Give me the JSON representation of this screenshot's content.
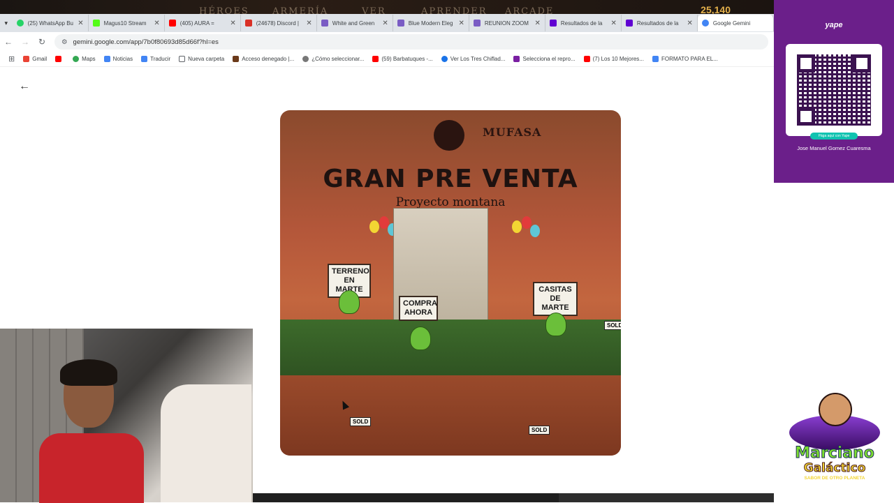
{
  "game_strip": {
    "labels": [
      "HÉROES",
      "ARMERÍA",
      "VER",
      "APRENDER",
      "ARCADE"
    ],
    "coins": "25,140"
  },
  "tabs": [
    {
      "title": "(25) WhatsApp Bu",
      "color": "#25d366"
    },
    {
      "title": "Magus10 Stream",
      "color": "#53fc18"
    },
    {
      "title": "(405) AURA =",
      "color": "#ff0000"
    },
    {
      "title": "(24678) Discord |",
      "color": "#d93025"
    },
    {
      "title": "White and Green",
      "color": "#7a5cc4"
    },
    {
      "title": "Blue Modern Eleg",
      "color": "#7a5cc4"
    },
    {
      "title": "REUNION ZOOM",
      "color": "#7a5cc4"
    },
    {
      "title": "Resultados de la",
      "color": "#6001d2"
    },
    {
      "title": "Resultados de la",
      "color": "#6001d2"
    },
    {
      "title": "Google Gemini",
      "color": "#4285f4"
    }
  ],
  "address": {
    "url": "gemini.google.com/app/7b0f80693d85d66f?hl=es"
  },
  "bookmarks": [
    {
      "label": "Gmail",
      "color": "#ea4335"
    },
    {
      "label": "",
      "color": "#ff0000"
    },
    {
      "label": "Maps",
      "color": "#34a853"
    },
    {
      "label": "Noticias",
      "color": "#4285f4"
    },
    {
      "label": "Traducir",
      "color": "#4285f4"
    },
    {
      "label": "Nueva carpeta",
      "color": "#5f6368"
    },
    {
      "label": "Acceso denegado |...",
      "color": "#6b3a1a"
    },
    {
      "label": "¿Cómo seleccionar...",
      "color": "#555555"
    },
    {
      "label": "(59) Barbatuques -...",
      "color": "#ff0000"
    },
    {
      "label": "Ver Los Tres Chiflad...",
      "color": "#1a73e8"
    },
    {
      "label": "Selecciona el repro...",
      "color": "#7a1fa2"
    },
    {
      "label": "(7) Los 10 Mejores...",
      "color": "#ff0000"
    },
    {
      "label": "FORMATO PARA EL...",
      "color": "#4285f4"
    }
  ],
  "poster": {
    "brand": "MUFASA",
    "headline": "GRAN PRE VENTA",
    "subtitle": "Proyecto montana",
    "sign_left": "TERRENO EN MARTE",
    "sign_center": "COMPRA AHORA",
    "sign_right": "CASITAS DE MARTE",
    "sold_label": "SOLD"
  },
  "qr_panel": {
    "logo": "yape",
    "pill": "Pága aquí con Yape",
    "name": "Jose Manuel Gomez Cuaresma"
  },
  "channel_logo": {
    "line1": "Marciano",
    "line2": "Galáctico",
    "tagline": "SABOR DE OTRO PLANETA"
  }
}
